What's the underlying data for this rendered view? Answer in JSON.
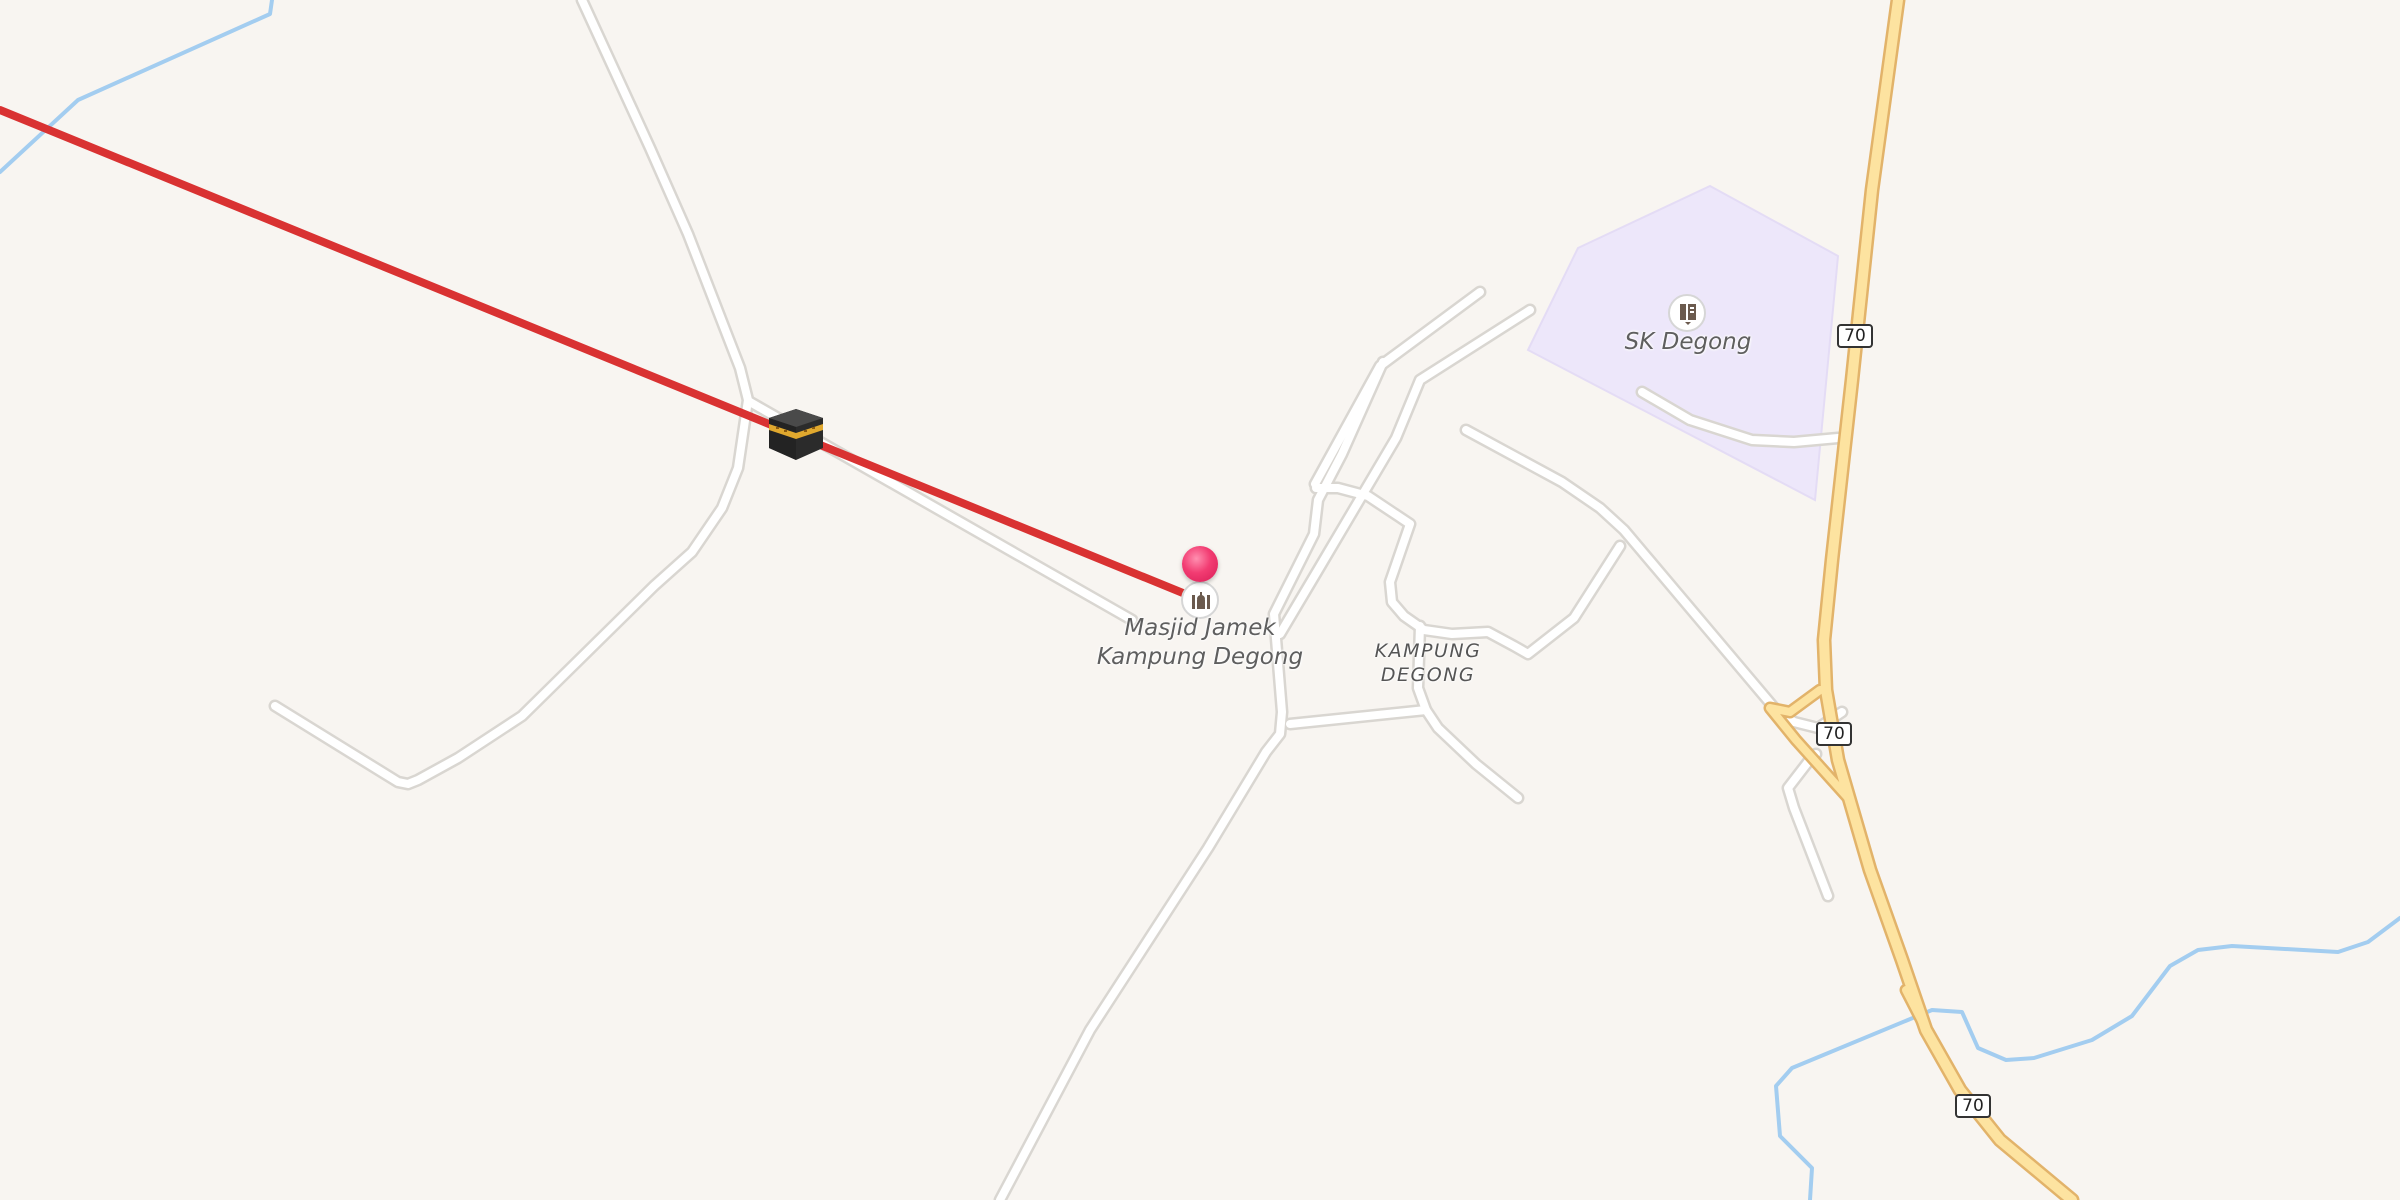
{
  "map": {
    "background": "#f8f5f1",
    "colors": {
      "road": "#ffffff",
      "road_casing": "#d9d6d1",
      "highway": "#fde3a0",
      "highway_casing": "#e2b36a",
      "river": "#a3cdf0",
      "school_area": "#ede7fa",
      "qibla_line": "#d93232",
      "pin": "#f23c72"
    },
    "qibla_line": {
      "marker_icon": "kaaba-icon"
    },
    "pois": [
      {
        "name": "Masjid Jamek Kampung Degong",
        "line1": "Masjid Jamek",
        "line2": "Kampung Degong",
        "icon": "mosque-icon"
      },
      {
        "name": "SK Degong",
        "icon": "school-icon"
      }
    ],
    "places": [
      {
        "line1": "KAMPUNG",
        "line2": "DEGONG"
      }
    ],
    "route_shields": [
      "70",
      "70",
      "70"
    ],
    "selected_marker": "location-pin-icon"
  }
}
